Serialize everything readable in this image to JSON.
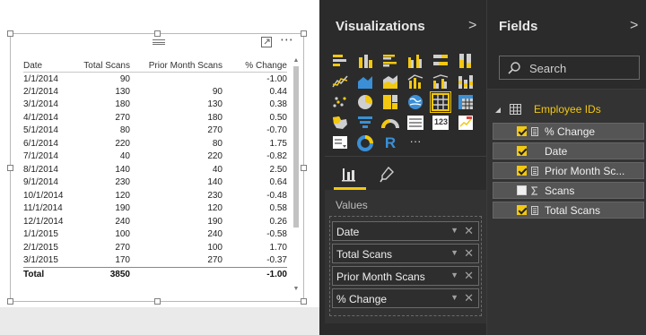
{
  "visual_table": {
    "columns": [
      "Date",
      "Total Scans",
      "Prior Month Scans",
      "% Change"
    ],
    "rows": [
      [
        "1/1/2014",
        "90",
        "",
        "-1.00"
      ],
      [
        "2/1/2014",
        "130",
        "90",
        "0.44"
      ],
      [
        "3/1/2014",
        "180",
        "130",
        "0.38"
      ],
      [
        "4/1/2014",
        "270",
        "180",
        "0.50"
      ],
      [
        "5/1/2014",
        "80",
        "270",
        "-0.70"
      ],
      [
        "6/1/2014",
        "220",
        "80",
        "1.75"
      ],
      [
        "7/1/2014",
        "40",
        "220",
        "-0.82"
      ],
      [
        "8/1/2014",
        "140",
        "40",
        "2.50"
      ],
      [
        "9/1/2014",
        "230",
        "140",
        "0.64"
      ],
      [
        "10/1/2014",
        "120",
        "230",
        "-0.48"
      ],
      [
        "11/1/2014",
        "190",
        "120",
        "0.58"
      ],
      [
        "12/1/2014",
        "240",
        "190",
        "0.26"
      ],
      [
        "1/1/2015",
        "100",
        "240",
        "-0.58"
      ],
      [
        "2/1/2015",
        "270",
        "100",
        "1.70"
      ],
      [
        "3/1/2015",
        "170",
        "270",
        "-0.37"
      ]
    ],
    "total_row": [
      "Total",
      "3850",
      "",
      "-1.00"
    ],
    "more_icon": "⋯"
  },
  "visualizations": {
    "title": "Visualizations",
    "chevron": ">",
    "icons": [
      "stacked-bar-chart-icon",
      "stacked-column-chart-icon",
      "clustered-bar-chart-icon",
      "clustered-column-chart-icon",
      "100pct-stacked-bar-chart-icon",
      "100pct-stacked-column-chart-icon",
      "line-chart-icon",
      "area-chart-icon",
      "stacked-area-chart-icon",
      "line-and-column-chart-icon",
      "line-and-clustered-column-chart-icon",
      "ribbon-chart-icon",
      "scatter-chart-icon",
      "pie-chart-icon",
      "treemap-icon",
      "map-icon",
      "table-icon",
      "matrix-icon",
      "filled-map-icon",
      "funnel-icon",
      "gauge-icon",
      "multi-row-card-icon",
      "card-icon",
      "kpi-icon",
      "slicer-icon",
      "donut-chart-icon",
      "r-script-visual-icon",
      "more-visuals-icon"
    ],
    "card_text": "123",
    "r_text": "R",
    "more_text": "···",
    "values_label": "Values",
    "wells": [
      "Date",
      "Total Scans",
      "Prior Month Scans",
      "% Change"
    ],
    "well_dropdown": "▼",
    "well_remove": "✕"
  },
  "fields": {
    "title": "Fields",
    "chevron": ">",
    "search_placeholder": "Search",
    "table_name": "Employee IDs",
    "items": [
      {
        "label": "% Change",
        "checked": true,
        "type": "calculated"
      },
      {
        "label": "Date",
        "checked": true,
        "type": "none"
      },
      {
        "label": "Prior Month Sc...",
        "checked": true,
        "type": "calculated"
      },
      {
        "label": "Scans",
        "checked": false,
        "type": "sum"
      },
      {
        "label": "Total Scans",
        "checked": true,
        "type": "calculated"
      }
    ]
  },
  "colors": {
    "accent": "#f2c811",
    "pane_bg": "#2b2b2b",
    "table_icon_selected": "#f2c811"
  }
}
